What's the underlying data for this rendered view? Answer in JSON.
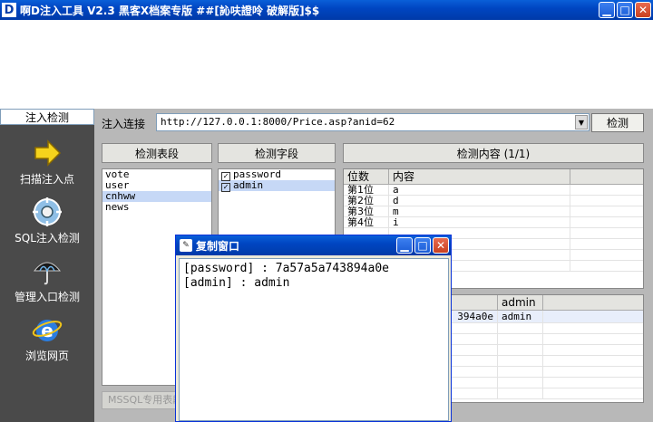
{
  "window": {
    "title": "啊D注入工具 V2.3 黑客X档案专版 ##[訫呋證呤 破解版]$$",
    "icon_letter": "D"
  },
  "sidebar": {
    "header": "注入检测",
    "items": [
      {
        "label": "扫描注入点",
        "icon": "arrow-icon"
      },
      {
        "label": "SQL注入检测",
        "icon": "gear-icon"
      },
      {
        "label": "管理入口检测",
        "icon": "umbrella-icon"
      },
      {
        "label": "浏览网页",
        "icon": "ie-icon"
      }
    ]
  },
  "main": {
    "url_label": "注入连接",
    "url_value": "http://127.0.0.1:8000/Price.asp?anid=62",
    "detect_button": "检测",
    "tables_header": "检测表段",
    "fields_header": "检测字段",
    "content_header": "检测内容 (1/1)",
    "tables": [
      {
        "name": "vote",
        "selected": false
      },
      {
        "name": "user",
        "selected": false
      },
      {
        "name": "cnhww",
        "selected": true
      },
      {
        "name": "news",
        "selected": false
      }
    ],
    "fields": [
      {
        "name": "password",
        "checked": true,
        "selected": false
      },
      {
        "name": "admin",
        "checked": true,
        "selected": true
      }
    ],
    "content_columns": [
      "位数",
      "内容"
    ],
    "content_rows": [
      [
        "第1位",
        "a"
      ],
      [
        "第2位",
        "d"
      ],
      [
        "第3位",
        "m"
      ],
      [
        "第4位",
        "i"
      ]
    ],
    "result_column": "admin",
    "result_partial": "394a0e",
    "result_value": "admin",
    "mssql_button": "MSSQL专用表段"
  },
  "dialog": {
    "title": "复制窗口",
    "lines": [
      "[password] : 7a57a5a743894a0e",
      "[admin] : admin"
    ]
  }
}
